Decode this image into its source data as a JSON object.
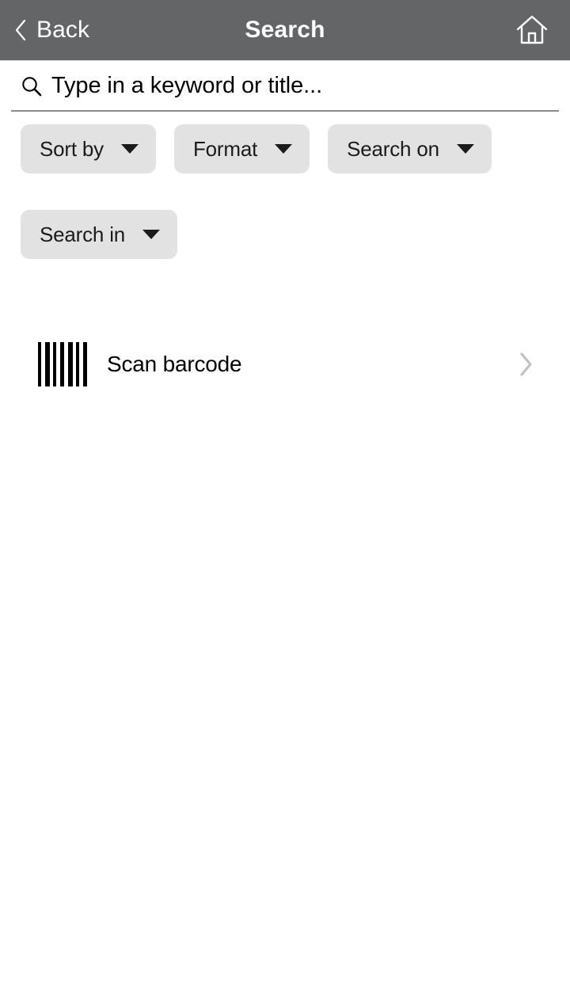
{
  "header": {
    "back_label": "Back",
    "title": "Search",
    "back_icon": "chevron-left-icon",
    "home_icon": "home-icon",
    "background_color": "#636567",
    "text_color": "#ffffff"
  },
  "search": {
    "placeholder": "Type in a keyword or title...",
    "value": "",
    "icon": "search-icon",
    "underline_color": "#8a8a8a"
  },
  "filters": {
    "chips": [
      {
        "label": "Sort by",
        "caret_icon": "chevron-down-icon",
        "selected": ""
      },
      {
        "label": "Format",
        "caret_icon": "chevron-down-icon",
        "selected": ""
      },
      {
        "label": "Search on",
        "caret_icon": "chevron-down-icon",
        "selected": ""
      },
      {
        "label": "Search in",
        "caret_icon": "chevron-down-icon",
        "selected": ""
      }
    ],
    "chip_background": "#e2e2e2",
    "chip_text_color": "#1b1b1b"
  },
  "actions": {
    "scan": {
      "label": "Scan barcode",
      "icon": "barcode-icon",
      "chevron_icon": "chevron-right-icon",
      "chevron_color": "#c0c0c0"
    }
  }
}
